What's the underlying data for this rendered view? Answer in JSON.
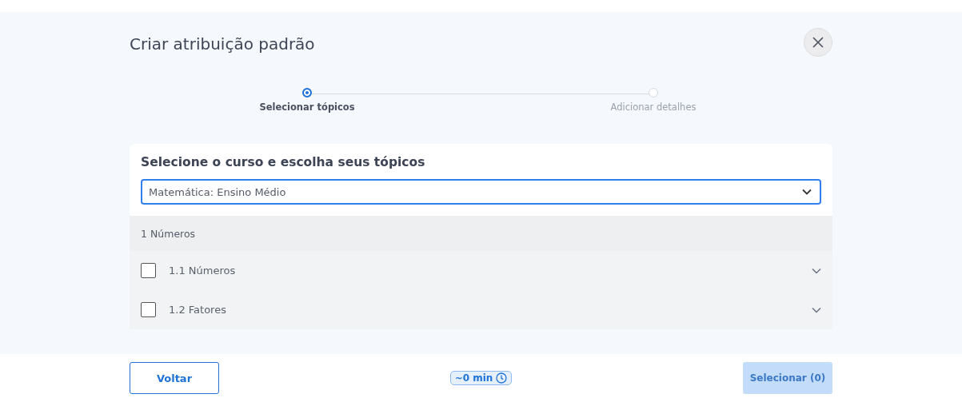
{
  "dialog": {
    "title": "Criar atribuição padrão"
  },
  "steps": [
    {
      "label": "Selecionar tópicos",
      "selected": true
    },
    {
      "label": "Adicionar detalhes",
      "selected": false
    }
  ],
  "course": {
    "heading": "Selecione o curso e escolha seus tópicos",
    "value": "Matemática: Ensino Médio"
  },
  "section": {
    "title": "1 Números"
  },
  "topics": [
    {
      "label": "1.1 Números",
      "checked": false
    },
    {
      "label": "1.2 Fatores",
      "checked": false
    }
  ],
  "footer": {
    "back": "Voltar",
    "duration": "~0 min",
    "submit": "Selecionar (0)",
    "submit_disabled": true
  }
}
